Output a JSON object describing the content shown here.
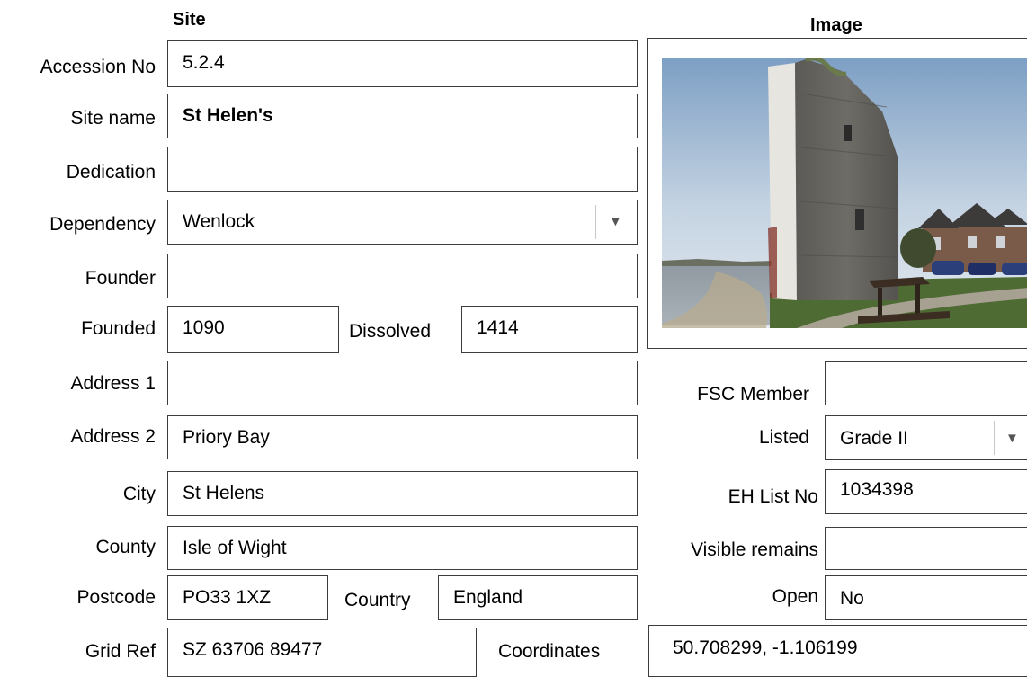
{
  "headers": {
    "site": "Site",
    "image": "Image"
  },
  "fields": {
    "accession_no": {
      "label": "Accession No",
      "value": "5.2.4"
    },
    "site_name": {
      "label": "Site name",
      "value": "St Helen's"
    },
    "dedication": {
      "label": "Dedication",
      "value": ""
    },
    "dependency": {
      "label": "Dependency",
      "value": "Wenlock"
    },
    "founder": {
      "label": "Founder",
      "value": ""
    },
    "founded": {
      "label": "Founded",
      "value": "1090"
    },
    "dissolved": {
      "label": "Dissolved",
      "value": "1414"
    },
    "address_1": {
      "label": "Address 1",
      "value": ""
    },
    "address_2": {
      "label": "Address 2",
      "value": "Priory Bay"
    },
    "city": {
      "label": "City",
      "value": "St Helens"
    },
    "county": {
      "label": "County",
      "value": "Isle of Wight"
    },
    "postcode": {
      "label": "Postcode",
      "value": "PO33 1XZ"
    },
    "country": {
      "label": "Country",
      "value": "England"
    },
    "grid_ref": {
      "label": "Grid Ref",
      "value": "SZ 63706 89477"
    },
    "coordinates": {
      "label": "Coordinates",
      "value": "50.708299,  -1.106199"
    },
    "fsc_member": {
      "label": "FSC Member",
      "value": ""
    },
    "listed": {
      "label": "Listed",
      "value": "Grade II"
    },
    "eh_list_no": {
      "label": "EH List No",
      "value": "1034398"
    },
    "visible_remains": {
      "label": "Visible remains",
      "value": ""
    },
    "open": {
      "label": "Open",
      "value": "No"
    }
  },
  "icons": {
    "dropdown": "chevron-down-icon"
  },
  "colors": {
    "border": "#3c3c3c",
    "background": "#ffffff",
    "text": "#000000"
  }
}
